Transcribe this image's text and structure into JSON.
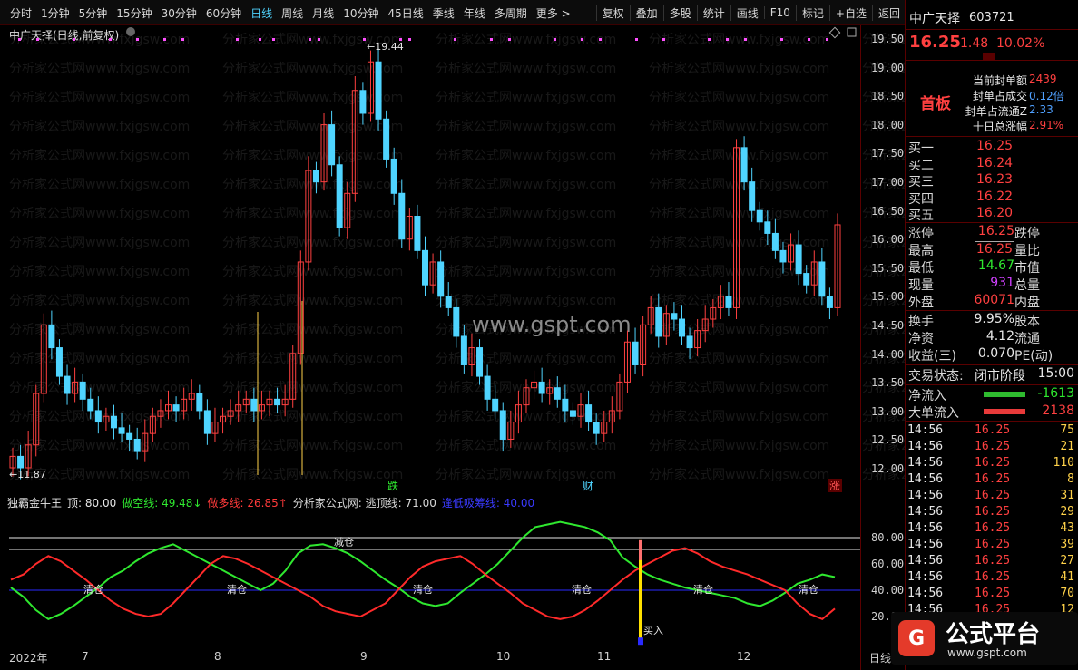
{
  "toolbar": {
    "periods": [
      "分时",
      "1分钟",
      "5分钟",
      "15分钟",
      "30分钟",
      "60分钟",
      "日线",
      "周线",
      "月线",
      "10分钟",
      "45日线",
      "季线",
      "年线",
      "多周期",
      "更多 >"
    ],
    "active_period": "日线",
    "tools": [
      "复权",
      "叠加",
      "多股",
      "统计",
      "画线",
      "F10",
      "标记",
      "+自选",
      "返回"
    ]
  },
  "chart": {
    "title": "中广天择(日线,前复权)",
    "high_label": "19.44",
    "low_label": "11.87",
    "watermark_center": "www.gspt.com",
    "watermark_tile": "分析家公式网www.fxjgsw.com",
    "price_axis": [
      "19.50",
      "19.00",
      "18.50",
      "18.00",
      "17.50",
      "17.00",
      "16.50",
      "16.00",
      "15.50",
      "15.00",
      "14.50",
      "14.00",
      "13.50",
      "13.00",
      "12.50",
      "12.00"
    ],
    "markers": [
      {
        "text": "跌",
        "color": "#2fe82f"
      },
      {
        "text": "财",
        "color": "#4fd4ff"
      },
      {
        "text": "涨",
        "color": "#ff5555"
      }
    ]
  },
  "indicator": {
    "name": "独霸金牛王",
    "top_label": "顶: 80.00",
    "short_line": "做空线: 49.48↓",
    "long_line": "做多线: 26.85↑",
    "source": "分析家公式网: 逃顶线: 71.00",
    "bottom_label": "逢低吸筹线: 40.00",
    "axis": [
      "80.00",
      "60.00",
      "40.00",
      "20.00"
    ],
    "labels_clear": "清仓",
    "label_reduce": "减仓",
    "label_buy": "买入"
  },
  "dates": [
    "2022年",
    "7",
    "8",
    "9",
    "10",
    "11",
    "12"
  ],
  "date_right": "日线",
  "quote": {
    "name": "中广天择",
    "code": "603721",
    "price": "16.25",
    "change": "1.48",
    "change_pct": "10.02%",
    "board": "首板",
    "seal_rows": [
      {
        "label": "当前封单额",
        "value": "2439"
      },
      {
        "label": "封单占成交",
        "value": "0.12倍"
      },
      {
        "label": "封单占流通Z",
        "value": "2.33"
      },
      {
        "label": "十日总涨幅",
        "value": "2.91%"
      }
    ],
    "bids": [
      {
        "label": "买一",
        "price": "16.25"
      },
      {
        "label": "买二",
        "price": "16.24"
      },
      {
        "label": "买三",
        "price": "16.23"
      },
      {
        "label": "买四",
        "price": "16.22"
      },
      {
        "label": "买五",
        "price": "16.20"
      }
    ],
    "stats": [
      {
        "label": "涨停",
        "value": "16.25",
        "label2": "跌停",
        "cls": "red"
      },
      {
        "label": "最高",
        "value": "16.25",
        "label2": "量比",
        "cls": "red"
      },
      {
        "label": "最低",
        "value": "14.67",
        "label2": "市值",
        "cls": "green"
      },
      {
        "label": "现量",
        "value": "931",
        "label2": "总量",
        "cls": "purple"
      },
      {
        "label": "外盘",
        "value": "60071",
        "label2": "内盘",
        "cls": "red"
      }
    ],
    "stats2": [
      {
        "label": "换手",
        "value": "9.95%",
        "label2": "股本"
      },
      {
        "label": "净资",
        "value": "4.12",
        "label2": "流通"
      },
      {
        "label": "收益(三)",
        "value": "0.070",
        "label2": "PE(动)"
      }
    ],
    "trade_status_label": "交易状态:",
    "trade_status": "闭市阶段",
    "trade_time": "15:00",
    "net_inflow_label": "净流入",
    "net_inflow": "-1613",
    "big_inflow_label": "大单流入",
    "big_inflow": "2138",
    "ticks": [
      {
        "time": "14:56",
        "price": "16.25",
        "vol": "75"
      },
      {
        "time": "14:56",
        "price": "16.25",
        "vol": "21"
      },
      {
        "time": "14:56",
        "price": "16.25",
        "vol": "110"
      },
      {
        "time": "14:56",
        "price": "16.25",
        "vol": "8"
      },
      {
        "time": "14:56",
        "price": "16.25",
        "vol": "31"
      },
      {
        "time": "14:56",
        "price": "16.25",
        "vol": "29"
      },
      {
        "time": "14:56",
        "price": "16.25",
        "vol": "43"
      },
      {
        "time": "14:56",
        "price": "16.25",
        "vol": "39"
      },
      {
        "time": "14:56",
        "price": "16.25",
        "vol": "27"
      },
      {
        "time": "14:56",
        "price": "16.25",
        "vol": "41"
      },
      {
        "time": "14:56",
        "price": "16.25",
        "vol": "70"
      },
      {
        "time": "14:56",
        "price": "16.25",
        "vol": "12"
      }
    ]
  },
  "logo": {
    "text": "公式平台",
    "url_text": "www.gspt.com"
  },
  "colors": {
    "up": "#ff4040",
    "down": "#4fd4ff",
    "short_line": "#2fe82f",
    "long_line": "#ff2a2a",
    "bottom_line": "#2a2aff"
  }
}
